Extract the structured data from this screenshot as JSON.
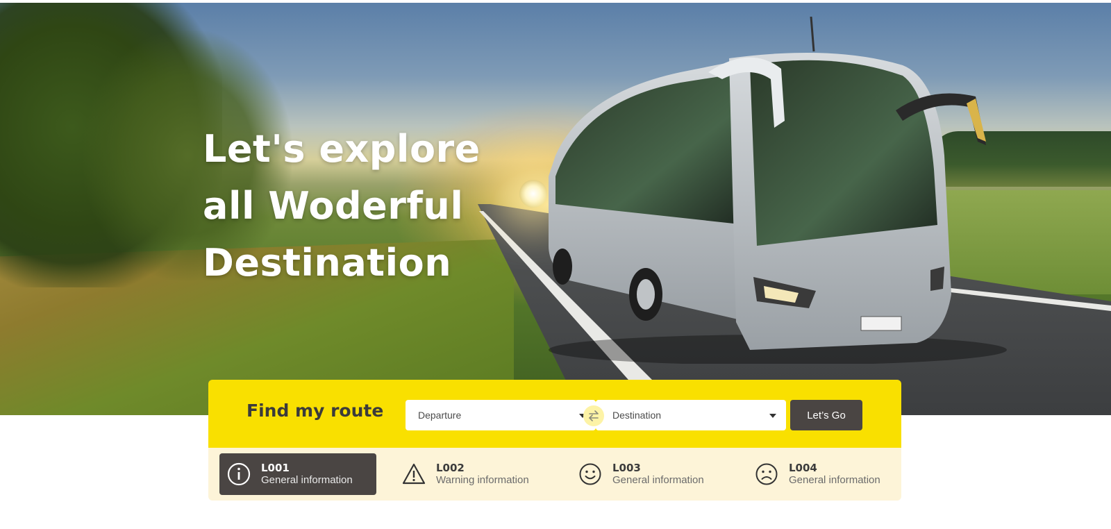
{
  "hero": {
    "title_lines": [
      "Let's explore",
      "all Woderful",
      "Destination"
    ]
  },
  "finder": {
    "title": "Find my route",
    "departure": {
      "value": "Departure"
    },
    "destination": {
      "value": "Destination"
    },
    "go_label": "Let’s Go"
  },
  "alerts": [
    {
      "code": "L001",
      "desc": "General information",
      "icon": "info-circle-icon",
      "active": true
    },
    {
      "code": "L002",
      "desc": "Warning information",
      "icon": "warning-triangle-icon",
      "active": false
    },
    {
      "code": "L003",
      "desc": "General information",
      "icon": "smile-face-icon",
      "active": false
    },
    {
      "code": "L004",
      "desc": "General information",
      "icon": "sad-face-icon",
      "active": false
    }
  ],
  "colors": {
    "accent_yellow": "#f9e000",
    "info_bg": "#fdf4d8",
    "dark_button": "#4a4543"
  }
}
